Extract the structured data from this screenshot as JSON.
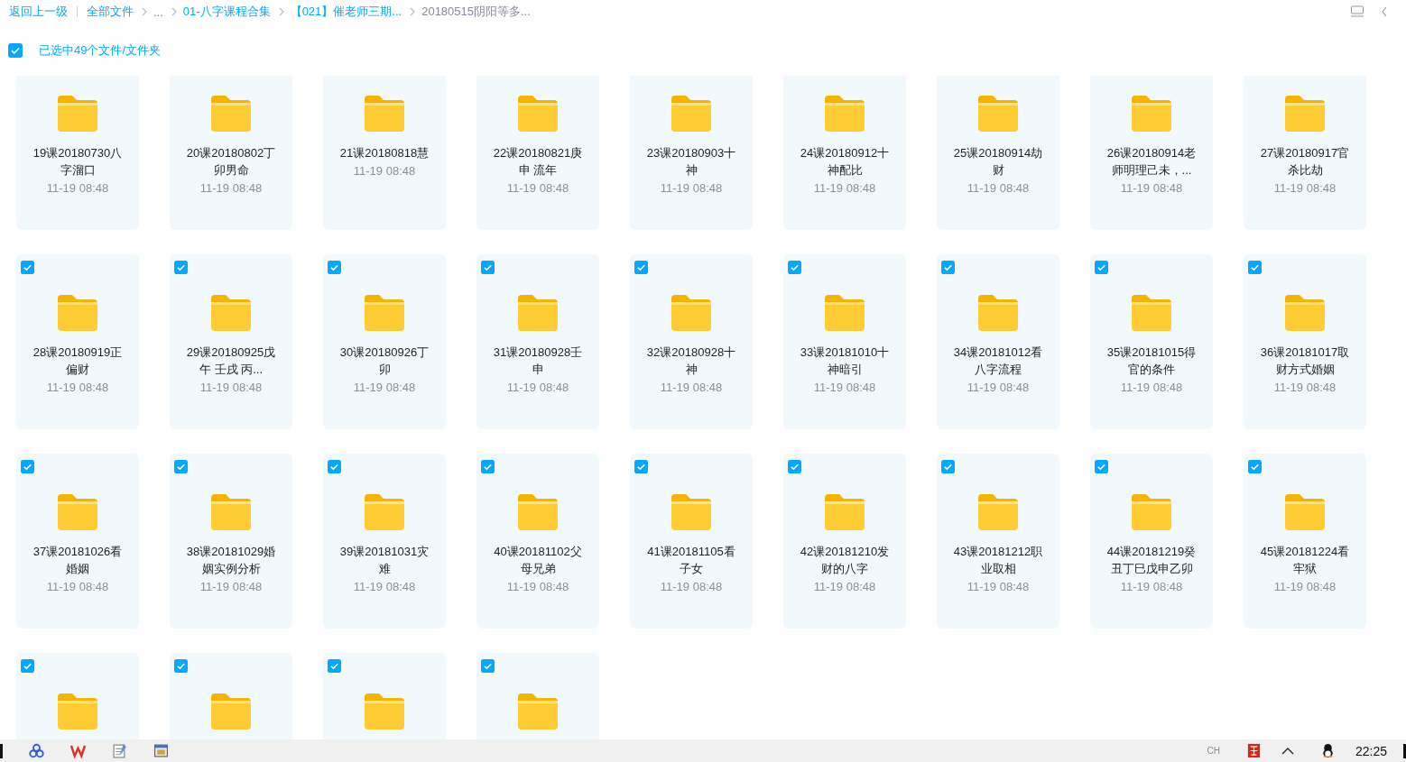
{
  "breadcrumb": {
    "back": "返回上一级",
    "items": [
      {
        "label": "全部文件",
        "current": false
      },
      {
        "label": "...",
        "current": false
      },
      {
        "label": "01-八字课程合集",
        "current": false
      },
      {
        "label": "【021】催老师三期...",
        "current": false
      },
      {
        "label": "20180515阴阳等多...",
        "current": true
      }
    ]
  },
  "selection": {
    "checked": true,
    "label": "已选中49个文件/文件夹"
  },
  "files": [
    {
      "name": "19课20180730八字溜口",
      "date": "11-19 08:48"
    },
    {
      "name": "20课20180802丁卯男命",
      "date": "11-19 08:48"
    },
    {
      "name": "21课20180818慧",
      "date": "11-19 08:48"
    },
    {
      "name": "22课20180821庚申 流年",
      "date": "11-19 08:48"
    },
    {
      "name": "23课20180903十神",
      "date": "11-19 08:48"
    },
    {
      "name": "24课20180912十神配比",
      "date": "11-19 08:48"
    },
    {
      "name": "25课20180914劫财",
      "date": "11-19 08:48"
    },
    {
      "name": "26课20180914老师明理己未，...",
      "date": "11-19 08:48"
    },
    {
      "name": "27课20180917官杀比劫",
      "date": "11-19 08:48"
    },
    {
      "name": "28课20180919正偏财",
      "date": "11-19 08:48",
      "selected": true
    },
    {
      "name": "29课20180925戊午 壬戌 丙...",
      "date": "11-19 08:48",
      "selected": true
    },
    {
      "name": "30课20180926丁卯",
      "date": "11-19 08:48",
      "selected": true
    },
    {
      "name": "31课20180928壬申",
      "date": "11-19 08:48",
      "selected": true
    },
    {
      "name": "32课20180928十神",
      "date": "11-19 08:48",
      "selected": true
    },
    {
      "name": "33课20181010十神暗引",
      "date": "11-19 08:48",
      "selected": true
    },
    {
      "name": "34课20181012看八字流程",
      "date": "11-19 08:48",
      "selected": true
    },
    {
      "name": "35课20181015得官的条件",
      "date": "11-19 08:48",
      "selected": true
    },
    {
      "name": "36课20181017取财方式婚姻",
      "date": "11-19 08:48",
      "selected": true
    },
    {
      "name": "37课20181026看婚姻",
      "date": "11-19 08:48",
      "selected": true
    },
    {
      "name": "38课20181029婚姻实例分析",
      "date": "11-19 08:48",
      "selected": true
    },
    {
      "name": "39课20181031灾难",
      "date": "11-19 08:48",
      "selected": true
    },
    {
      "name": "40课20181102父母兄弟",
      "date": "11-19 08:48",
      "selected": true
    },
    {
      "name": "41课20181105看子女",
      "date": "11-19 08:48",
      "selected": true
    },
    {
      "name": "42课20181210发财的八字",
      "date": "11-19 08:48",
      "selected": true
    },
    {
      "name": "43课20181212职业取相",
      "date": "11-19 08:48",
      "selected": true
    },
    {
      "name": "44课20181219癸丑丁巳戊申乙卯",
      "date": "11-19 08:48",
      "selected": true
    },
    {
      "name": "45课20181224看牢狱",
      "date": "11-19 08:48",
      "selected": true
    },
    {
      "selected": true
    },
    {
      "selected": true
    },
    {
      "selected": true
    },
    {
      "selected": true
    }
  ],
  "taskbar": {
    "ime": "CH",
    "clock": "22:25"
  }
}
